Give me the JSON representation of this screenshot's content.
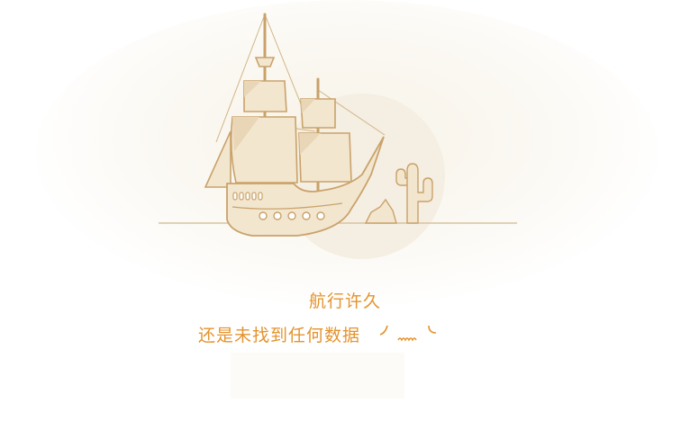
{
  "empty_state": {
    "title": "航行许久",
    "message": "还是未找到任何数据",
    "illustration": "sailing-ship-desert-icon",
    "emoticon": "shrug-emoticon-icon"
  },
  "colors": {
    "accent": "#e4932d",
    "line": "#c9a26a",
    "sail_fill": "#f3e6cf",
    "bg_glow": "#f7f2e6"
  }
}
